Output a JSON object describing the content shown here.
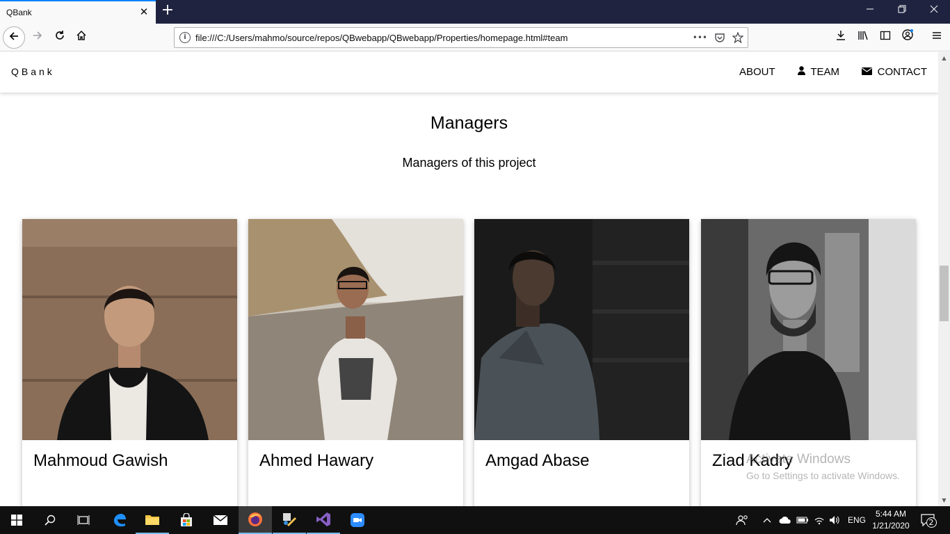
{
  "browser": {
    "tab_title": "QBank",
    "tab_close": "✕",
    "new_tab": "+",
    "url": "file:///C:/Users/mahmo/source/repos/QBwebapp/QBwebapp/Properties/homepage.html#team",
    "url_more": "•••"
  },
  "site": {
    "brand": "QBank",
    "nav": [
      {
        "label": "ABOUT",
        "icon": ""
      },
      {
        "label": "TEAM",
        "icon": "user-icon"
      },
      {
        "label": "CONTACT",
        "icon": "envelope-icon"
      }
    ]
  },
  "section": {
    "title": "Managers",
    "subtitle": "Managers of this project"
  },
  "team": [
    {
      "name": "Mahmoud Gawish"
    },
    {
      "name": "Ahmed Hawary"
    },
    {
      "name": "Amgad Abase"
    },
    {
      "name": "Ziad Kadry"
    }
  ],
  "watermark": {
    "title": "Activate Windows",
    "subtitle": "Go to Settings to activate Windows."
  },
  "taskbar": {
    "language": "ENG",
    "time": "5:44 AM",
    "date": "1/21/2020",
    "notifications": "2"
  },
  "colors": {
    "tab_bar": "#202340",
    "accent": "#0a84ff",
    "taskbar": "#101010"
  }
}
